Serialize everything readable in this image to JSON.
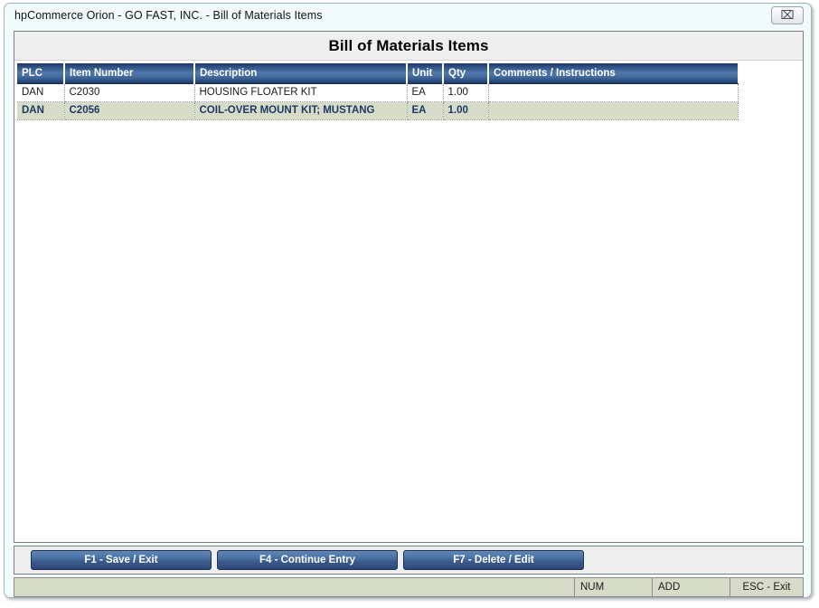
{
  "window": {
    "title": "hpCommerce Orion - GO FAST, INC. - Bill of Materials Items",
    "close_icon": "close-icon",
    "close_glyph": "⌧"
  },
  "panel": {
    "title": "Bill of Materials Items"
  },
  "grid": {
    "columns": [
      {
        "key": "plc",
        "label": "PLC"
      },
      {
        "key": "item",
        "label": "Item Number"
      },
      {
        "key": "desc",
        "label": "Description"
      },
      {
        "key": "unit",
        "label": "Unit"
      },
      {
        "key": "qty",
        "label": "Qty"
      },
      {
        "key": "comments",
        "label": "Comments / Instructions"
      }
    ],
    "rows": [
      {
        "selected": false,
        "cells": [
          "DAN",
          "C2030",
          "HOUSING FLOATER KIT",
          "EA",
          "1.00",
          ""
        ]
      },
      {
        "selected": true,
        "cells": [
          "DAN",
          "C2056",
          "COIL-OVER MOUNT KIT; MUSTANG",
          "EA",
          "1.00",
          ""
        ]
      }
    ]
  },
  "buttons": [
    {
      "id": "save",
      "label": "F1 - Save / Exit"
    },
    {
      "id": "continue",
      "label": "F4 - Continue Entry"
    },
    {
      "id": "delete",
      "label": "F7 - Delete / Edit"
    }
  ],
  "status": {
    "main": "",
    "num": "NUM",
    "add": "ADD",
    "esc": "ESC - Exit"
  },
  "colors": {
    "header_gradient_top": "#1f3864",
    "header_gradient_mid": "#4f79ab",
    "selected_row_bg": "#d7dcc9",
    "selected_row_text": "#1f3864",
    "button_gradient_top": "#5f86b4",
    "button_gradient_bottom": "#2c4878",
    "window_bg": "#f2fbfb",
    "panel_header_bg": "#efefef"
  }
}
